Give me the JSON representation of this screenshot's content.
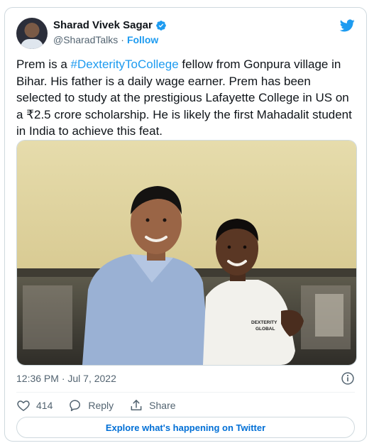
{
  "author": {
    "name": "Sharad Vivek Sagar",
    "handle": "@SharadTalks",
    "follow_label": "Follow"
  },
  "tweet": {
    "text_before": "Prem is a ",
    "hashtag": "#DexterityToCollege",
    "text_after": " fellow from Gonpura village in Bihar. His father is a daily wage earner. Prem has been selected to study at the prestigious Lafayette College in US on a ₹2.5 crore scholarship. He is likely the first Mahadalit student in India to achieve this feat."
  },
  "photo": {
    "shirt_text_line1": "DEXTERITY",
    "shirt_text_line2": "GLOBAL"
  },
  "meta": {
    "timestamp": "12:36 PM · Jul 7, 2022"
  },
  "actions": {
    "like_count": "414",
    "reply_label": "Reply",
    "share_label": "Share"
  },
  "explore_label": "Explore what's happening on Twitter",
  "colors": {
    "accent": "#1d9bf0",
    "link": "#006fd6",
    "secondary_text": "#536471",
    "border": "#cfd9de"
  }
}
